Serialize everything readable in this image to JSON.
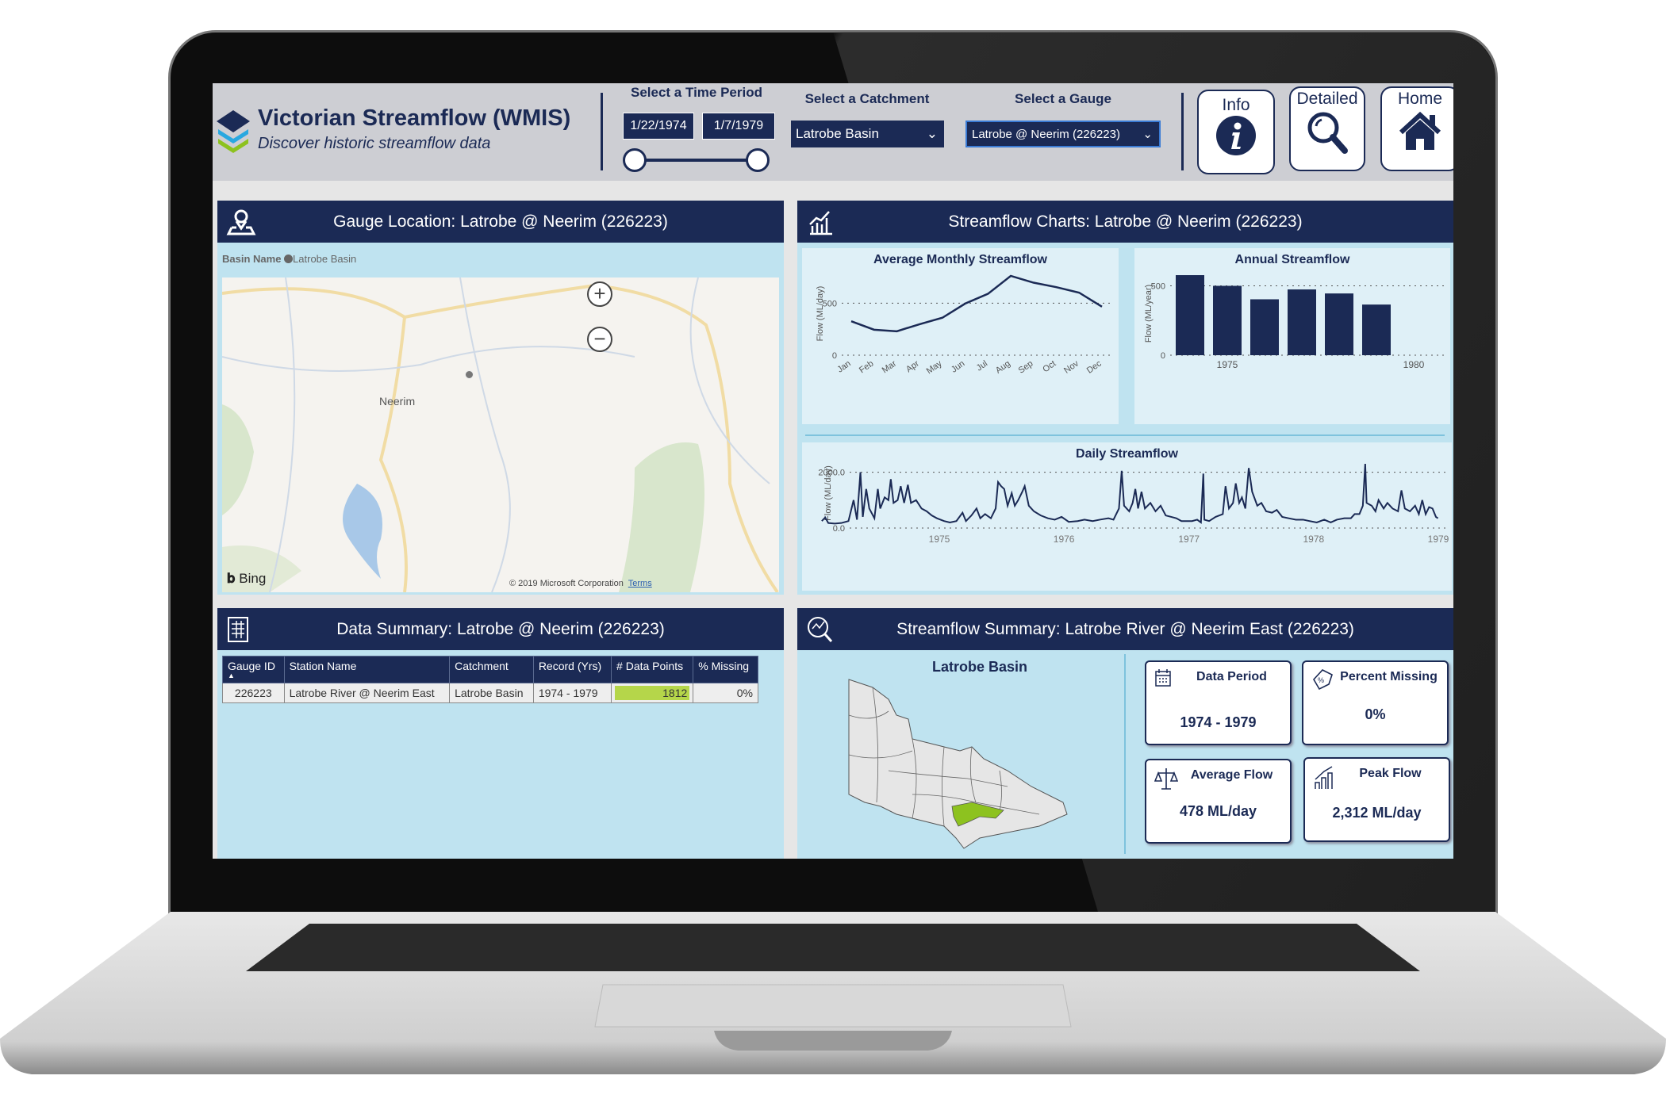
{
  "header": {
    "title": "Victorian Streamflow (WMIS)",
    "subtitle": "Discover historic streamflow data",
    "time_period_label": "Select a Time Period",
    "start_date": "1/22/1974",
    "end_date": "1/7/1979",
    "range_fraction": [
      0,
      1
    ],
    "catchment_label": "Select  a Catchment",
    "catchment_value": "Latrobe Basin",
    "gauge_label": "Select a Gauge",
    "gauge_value": "Latrobe @ Neerim (226223)",
    "buttons": [
      {
        "label": "Info",
        "icon": "info-icon"
      },
      {
        "label": "Detailed",
        "icon": "magnifier-icon"
      },
      {
        "label": "Home",
        "icon": "home-icon"
      }
    ]
  },
  "gauge_location": {
    "title": "Gauge Location: Latrobe @ Neerim (226223)",
    "legend_title": "Basin Name",
    "legend_item": "Latrobe Basin",
    "place_label": "Neerim",
    "bing": "Bing",
    "copyright": "© 2019 Microsoft Corporation",
    "terms": "Terms"
  },
  "charts_panel": {
    "title": "Streamflow Charts: Latrobe @ Neerim (226223)"
  },
  "chart_data": [
    {
      "type": "line",
      "title": "Average Monthly Streamflow",
      "ylabel": "Flow (ML/day)",
      "xlabel": "",
      "ylim": [
        0,
        800
      ],
      "yticks": [
        "0",
        "500"
      ],
      "grid": true,
      "categories": [
        "Jan",
        "Feb",
        "Mar",
        "Apr",
        "May",
        "Jun",
        "Jul",
        "Aug",
        "Sep",
        "Oct",
        "Nov",
        "Dec"
      ],
      "values": [
        326,
        245,
        230,
        298,
        360,
        496,
        590,
        762,
        697,
        654,
        601,
        466
      ]
    },
    {
      "type": "bar",
      "title": "Annual Streamflow",
      "ylabel": "Flow (ML/year)",
      "xlabel": "",
      "ylim": [
        0,
        600
      ],
      "yticks": [
        "0",
        "500"
      ],
      "xticks": [
        "1975",
        "1980"
      ],
      "grid": true,
      "categories": [
        "1974",
        "1975",
        "1976",
        "1977",
        "1978",
        "1979"
      ],
      "values": [
        577,
        500,
        403,
        474,
        445,
        365
      ]
    },
    {
      "type": "line",
      "title": "Daily Streamflow",
      "ylabel": "Flow (ML/day)",
      "xlabel": "",
      "ylim": [
        0,
        2500
      ],
      "yticks": [
        "0.0",
        "2000.0"
      ],
      "xticks": [
        "1975",
        "1976",
        "1977",
        "1978",
        "1979"
      ],
      "grid": true,
      "points": [
        [
          "1974-01-22",
          250
        ],
        [
          "1974-02-01",
          380
        ],
        [
          "1974-02-10",
          180
        ],
        [
          "1974-03-01",
          160
        ],
        [
          "1974-03-20",
          180
        ],
        [
          "1974-04-10",
          250
        ],
        [
          "1974-04-25",
          1000
        ],
        [
          "1974-05-05",
          300
        ],
        [
          "1974-05-15",
          2000
        ],
        [
          "1974-05-22",
          400
        ],
        [
          "1974-06-01",
          1400
        ],
        [
          "1974-06-10",
          700
        ],
        [
          "1974-06-25",
          350
        ],
        [
          "1974-07-05",
          1400
        ],
        [
          "1974-07-12",
          700
        ],
        [
          "1974-07-25",
          1100
        ],
        [
          "1974-08-05",
          1000
        ],
        [
          "1974-08-12",
          1750
        ],
        [
          "1974-08-20",
          900
        ],
        [
          "1974-09-01",
          1000
        ],
        [
          "1974-09-10",
          1500
        ],
        [
          "1974-09-20",
          900
        ],
        [
          "1974-10-01",
          1550
        ],
        [
          "1974-10-10",
          900
        ],
        [
          "1974-10-25",
          1000
        ],
        [
          "1974-11-10",
          700
        ],
        [
          "1974-11-25",
          600
        ],
        [
          "1974-12-10",
          450
        ],
        [
          "1974-12-25",
          350
        ],
        [
          "1975-01-15",
          250
        ],
        [
          "1975-02-01",
          200
        ],
        [
          "1975-02-20",
          250
        ],
        [
          "1975-03-10",
          550
        ],
        [
          "1975-03-20",
          250
        ],
        [
          "1975-04-05",
          450
        ],
        [
          "1975-04-20",
          700
        ],
        [
          "1975-05-01",
          350
        ],
        [
          "1975-05-15",
          500
        ],
        [
          "1975-06-01",
          350
        ],
        [
          "1975-06-15",
          700
        ],
        [
          "1975-06-22",
          1650
        ],
        [
          "1975-07-01",
          1500
        ],
        [
          "1975-07-10",
          1400
        ],
        [
          "1975-07-20",
          800
        ],
        [
          "1975-08-01",
          1250
        ],
        [
          "1975-08-10",
          800
        ],
        [
          "1975-08-20",
          1000
        ],
        [
          "1975-09-01",
          1300
        ],
        [
          "1975-09-08",
          1500
        ],
        [
          "1975-09-20",
          800
        ],
        [
          "1975-10-05",
          600
        ],
        [
          "1975-10-25",
          450
        ],
        [
          "1975-11-15",
          350
        ],
        [
          "1975-12-05",
          300
        ],
        [
          "1975-12-25",
          400
        ],
        [
          "1976-01-15",
          220
        ],
        [
          "1976-02-10",
          250
        ],
        [
          "1976-03-01",
          300
        ],
        [
          "1976-03-25",
          250
        ],
        [
          "1976-04-15",
          300
        ],
        [
          "1976-05-10",
          350
        ],
        [
          "1976-05-25",
          300
        ],
        [
          "1976-06-10",
          700
        ],
        [
          "1976-06-18",
          2050
        ],
        [
          "1976-06-25",
          800
        ],
        [
          "1976-07-10",
          600
        ],
        [
          "1976-07-20",
          900
        ],
        [
          "1976-07-28",
          1400
        ],
        [
          "1976-08-05",
          700
        ],
        [
          "1976-08-15",
          1300
        ],
        [
          "1976-08-25",
          700
        ],
        [
          "1976-09-10",
          900
        ],
        [
          "1976-09-25",
          600
        ],
        [
          "1976-10-10",
          800
        ],
        [
          "1976-10-25",
          450
        ],
        [
          "1976-11-10",
          400
        ],
        [
          "1976-11-25",
          350
        ],
        [
          "1976-12-10",
          250
        ],
        [
          "1976-12-25",
          250
        ],
        [
          "1977-01-10",
          250
        ],
        [
          "1977-01-25",
          300
        ],
        [
          "1977-02-05",
          200
        ],
        [
          "1977-02-12",
          1950
        ],
        [
          "1977-02-15",
          300
        ],
        [
          "1977-03-01",
          250
        ],
        [
          "1977-03-20",
          400
        ],
        [
          "1977-04-10",
          500
        ],
        [
          "1977-04-18",
          1500
        ],
        [
          "1977-04-28",
          700
        ],
        [
          "1977-05-10",
          900
        ],
        [
          "1977-05-18",
          1600
        ],
        [
          "1977-05-28",
          900
        ],
        [
          "1977-06-05",
          1100
        ],
        [
          "1977-06-15",
          700
        ],
        [
          "1977-06-25",
          2150
        ],
        [
          "1977-07-05",
          1300
        ],
        [
          "1977-07-20",
          800
        ],
        [
          "1977-08-01",
          900
        ],
        [
          "1977-08-15",
          600
        ],
        [
          "1977-09-01",
          550
        ],
        [
          "1977-09-15",
          650
        ],
        [
          "1977-10-01",
          400
        ],
        [
          "1977-10-20",
          350
        ],
        [
          "1977-11-10",
          300
        ],
        [
          "1977-12-01",
          300
        ],
        [
          "1977-12-20",
          250
        ],
        [
          "1978-01-10",
          200
        ],
        [
          "1978-02-01",
          300
        ],
        [
          "1978-02-20",
          200
        ],
        [
          "1978-03-10",
          300
        ],
        [
          "1978-04-01",
          350
        ],
        [
          "1978-04-20",
          350
        ],
        [
          "1978-05-01",
          500
        ],
        [
          "1978-05-15",
          500
        ],
        [
          "1978-05-25",
          800
        ],
        [
          "1978-06-01",
          2300
        ],
        [
          "1978-06-05",
          900
        ],
        [
          "1978-06-20",
          800
        ],
        [
          "1978-07-01",
          600
        ],
        [
          "1978-07-10",
          1000
        ],
        [
          "1978-07-25",
          700
        ],
        [
          "1978-08-05",
          900
        ],
        [
          "1978-08-20",
          700
        ],
        [
          "1978-09-05",
          600
        ],
        [
          "1978-09-15",
          1350
        ],
        [
          "1978-09-25",
          700
        ],
        [
          "1978-10-10",
          600
        ],
        [
          "1978-10-25",
          800
        ],
        [
          "1978-11-05",
          500
        ],
        [
          "1978-11-15",
          1000
        ],
        [
          "1978-11-25",
          500
        ],
        [
          "1978-12-05",
          750
        ],
        [
          "1978-12-15",
          700
        ],
        [
          "1978-12-25",
          400
        ],
        [
          "1978-12-31",
          350
        ]
      ]
    }
  ],
  "data_summary": {
    "title": "Data Summary: Latrobe @ Neerim (226223)",
    "columns": [
      "Gauge ID",
      "Station Name",
      "Catchment",
      "Record (Yrs)",
      "# Data Points",
      "% Missing"
    ],
    "rows": [
      [
        "226223",
        "Latrobe River @ Neerim East",
        "Latrobe Basin",
        "1974 - 1979",
        "1812",
        "0%"
      ]
    ],
    "highlight_color": "#b5d64a"
  },
  "streamflow_summary": {
    "title": "Streamflow Summary: Latrobe River @ Neerim East (226223)",
    "basin_title": "Latrobe Basin",
    "highlight_color": "#8dc21f",
    "cards": [
      {
        "label": "Data Period",
        "value": "1974 - 1979"
      },
      {
        "label": "Percent Missing",
        "value": "0%"
      },
      {
        "label": "Average Flow",
        "value": "478 ML/day"
      },
      {
        "label": "Peak Flow",
        "value": "2,312 ML/day"
      }
    ]
  },
  "colors": {
    "navy": "#1b2a55",
    "panel": "#bfe3f0"
  }
}
